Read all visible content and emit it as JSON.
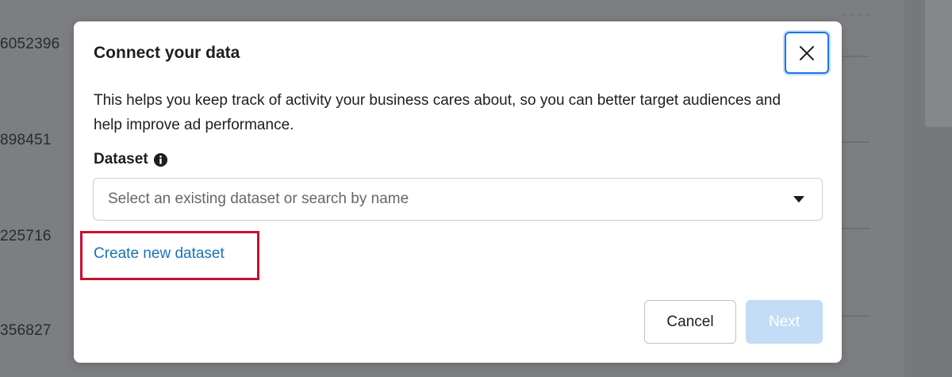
{
  "background": {
    "numbers": [
      "6052396",
      "898451",
      "225716",
      "356827"
    ]
  },
  "modal": {
    "title": "Connect your data",
    "description": "This helps you keep track of activity your business cares about, so you can better target audiences and help improve ad performance.",
    "dataset_label": "Dataset",
    "dataset_info_icon": "info-circle-icon",
    "dataset_select": {
      "placeholder": "Select an existing dataset or search by name",
      "caret_icon": "caret-down-icon"
    },
    "create_link": "Create new dataset",
    "close_icon": "close-icon",
    "buttons": {
      "cancel": "Cancel",
      "next": "Next"
    }
  },
  "colors": {
    "accent": "#1877f2",
    "link": "#1a73b8",
    "highlight_box": "#c8102e",
    "next_disabled": "#c3dcf6"
  }
}
